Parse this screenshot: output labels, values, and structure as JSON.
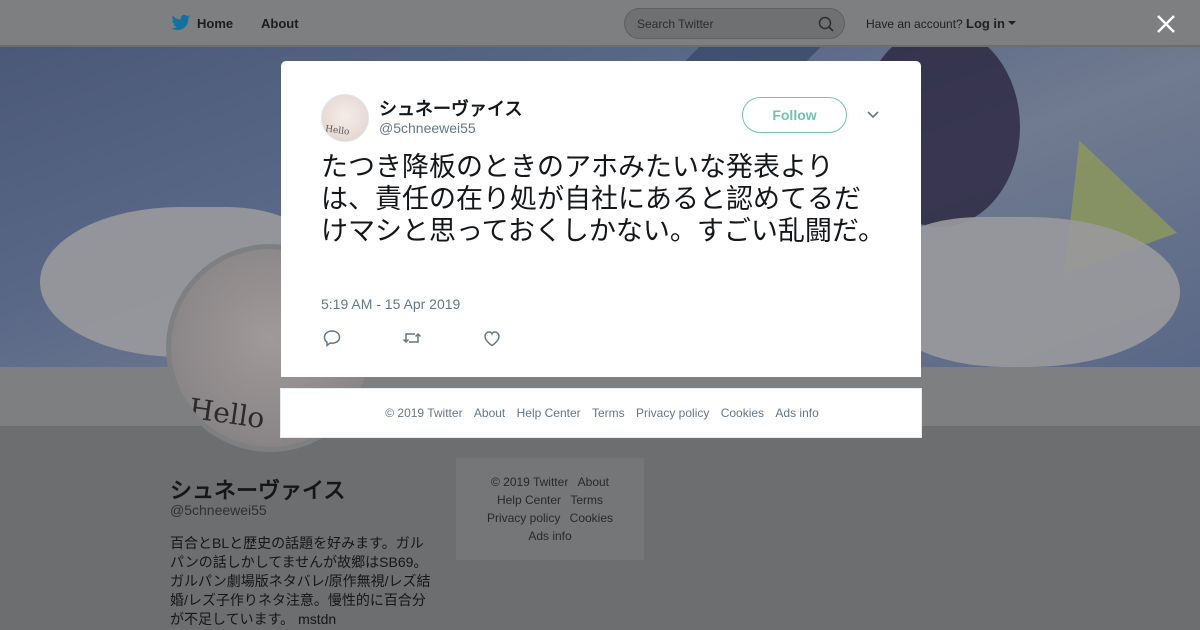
{
  "background": {
    "nav": {
      "home": "Home",
      "about": "About"
    },
    "search": {
      "placeholder": "Search Twitter"
    },
    "account": {
      "prompt": "Have an account?",
      "login": "Log in"
    },
    "profile": {
      "name": "シュネーヴァイス",
      "handle": "@5chneewei55",
      "bio": "百合とBLと歴史の話題を好みます。ガルパンの話しかしてませんが故郷はSB69。ガルパン劇場版ネタバレ/原作無視/レズ結婚/レズ子作りネタ注意。慢性的に百合分が不足しています。 mstdn",
      "avatar_text": "Hello"
    },
    "side_footer": {
      "copyright": "© 2019 Twitter",
      "about": "About",
      "help": "Help Center",
      "terms": "Terms",
      "privacy": "Privacy policy",
      "cookies": "Cookies",
      "ads": "Ads info"
    }
  },
  "tweet": {
    "author": {
      "name": "シュネーヴァイス",
      "handle": "@5chneewei55",
      "avatar_text": "Hello"
    },
    "follow_label": "Follow",
    "text": "たつき降板のときのアホみたいな発表よりは、責任の在り処が自社にあると認めてるだけマシと思っておくしかない。すごい乱闘だ。",
    "timestamp": "5:19 AM - 15 Apr 2019",
    "icons": [
      "reply-icon",
      "retweet-icon",
      "like-icon",
      "chevron-down-icon",
      "close-icon"
    ]
  },
  "modal_footer": {
    "copyright": "© 2019 Twitter",
    "about": "About",
    "help": "Help Center",
    "terms": "Terms",
    "privacy": "Privacy policy",
    "cookies": "Cookies",
    "ads": "Ads info"
  },
  "colors": {
    "accent": "#1da1f2",
    "follow": "#6cc6ad",
    "muted": "#657786",
    "text": "#14171a"
  }
}
